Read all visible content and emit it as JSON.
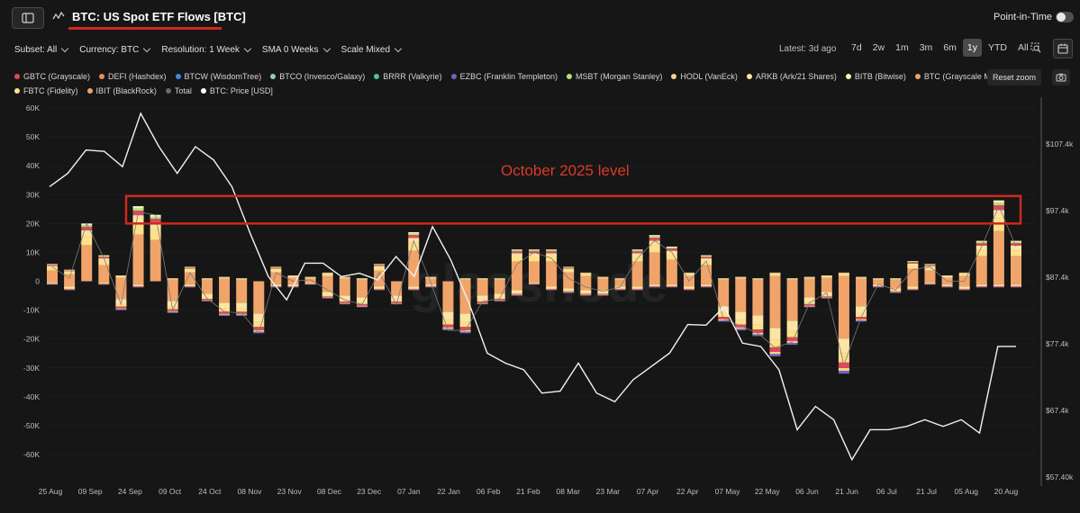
{
  "header": {
    "title": "BTC: US Spot ETF Flows [BTC]",
    "pit_label": "Point-in-Time"
  },
  "controls": {
    "subset": "Subset: All",
    "currency": "Currency: BTC",
    "resolution": "Resolution: 1 Week",
    "sma": "SMA 0 Weeks",
    "scale": "Scale Mixed",
    "latest": "Latest: 3d ago",
    "ranges": [
      "7d",
      "2w",
      "1m",
      "3m",
      "6m",
      "1y",
      "YTD",
      "All"
    ],
    "active_range": "1y",
    "reset_zoom": "Reset zoom"
  },
  "legend": [
    {
      "name": "GBTC (Grayscale)",
      "color": "#e0475b"
    },
    {
      "name": "DEFI (Hashdex)",
      "color": "#f08a5a"
    },
    {
      "name": "BTCW (WisdomTree)",
      "color": "#3d8bd9"
    },
    {
      "name": "BTCO (Invesco/Galaxy)",
      "color": "#8fd1a8"
    },
    {
      "name": "BRRR (Valkyrie)",
      "color": "#47c4a0"
    },
    {
      "name": "EZBC (Franklin Templeton)",
      "color": "#6f63c9"
    },
    {
      "name": "MSBT (Morgan Stanley)",
      "color": "#b6e07a"
    },
    {
      "name": "HODL (VanEck)",
      "color": "#f4d483"
    },
    {
      "name": "ARKB (Ark/21 Shares)",
      "color": "#fbe4a6"
    },
    {
      "name": "BITB (Bitwise)",
      "color": "#fff3b8"
    },
    {
      "name": "BTC (Grayscale Mini)",
      "color": "#f2a25c"
    },
    {
      "name": "FBTC (Fidelity)",
      "color": "#ffe08a"
    },
    {
      "name": "IBIT (BlackRock)",
      "color": "#f0a46a"
    },
    {
      "name": "Total",
      "color": "#6b6b6b"
    },
    {
      "name": "BTC: Price [USD]",
      "color": "#ffffff"
    }
  ],
  "annotation": {
    "text": "October 2025 level"
  },
  "watermark": "glassnode",
  "chart_data": {
    "type": "bar",
    "y_left_ticks": [
      "60K",
      "50K",
      "40K",
      "30K",
      "20K",
      "10K",
      "0",
      "-10K",
      "-20K",
      "-30K",
      "-40K",
      "-50K",
      "-60K"
    ],
    "y_right_ticks": [
      "$107.4k",
      "$97.4k",
      "$87.4k",
      "$77.4k",
      "$67.4k",
      "$57.40k"
    ],
    "x_ticks": [
      "25 Aug",
      "09 Sep",
      "24 Sep",
      "09 Oct",
      "24 Oct",
      "08 Nov",
      "23 Nov",
      "08 Dec",
      "23 Dec",
      "07 Jan",
      "22 Jan",
      "06 Feb",
      "21 Feb",
      "08 Mar",
      "23 Mar",
      "07 Apr",
      "22 Apr",
      "07 May",
      "22 May",
      "06 Jun",
      "21 Jun",
      "06 Jul",
      "21 Jul",
      "05 Aug",
      "20 Aug"
    ],
    "ylim": [
      -60000,
      60000
    ],
    "weekly_pos": [
      6000,
      4000,
      20000,
      9000,
      2000,
      26000,
      23000,
      1000,
      5000,
      1000,
      1500,
      1000,
      0,
      5000,
      2000,
      1500,
      3000,
      1500,
      1000,
      6000,
      0,
      17000,
      1500,
      0,
      1000,
      1000,
      1000,
      11000,
      11000,
      11000,
      5000,
      3000,
      1500,
      1000,
      11000,
      16000,
      12000,
      3000,
      9000,
      1000,
      1500,
      1000,
      3000,
      1000,
      1500,
      2000,
      3000,
      1500,
      1000,
      1000,
      7000,
      6000,
      2000,
      3000,
      14000,
      28000,
      14000
    ],
    "weekly_neg": [
      -1000,
      -3000,
      0,
      -1000,
      -10000,
      -2000,
      0,
      -11000,
      -2000,
      -7000,
      -12000,
      -12000,
      -18000,
      -2000,
      -2000,
      -1000,
      -6000,
      -8000,
      -9000,
      -3000,
      -8000,
      -3000,
      -2000,
      -17000,
      -18000,
      -8000,
      -7000,
      -5000,
      -1000,
      -3000,
      -4000,
      -5000,
      -5000,
      -3000,
      -3000,
      -2000,
      -2000,
      -3000,
      -2000,
      -14000,
      -17000,
      -19000,
      -26000,
      -22000,
      -9000,
      -6000,
      -32000,
      -14000,
      -2000,
      -4000,
      -3000,
      -1000,
      -2000,
      -3000,
      -2000,
      -2000,
      -2000
    ],
    "total": [
      5000,
      1000,
      20000,
      8000,
      -8000,
      24000,
      23000,
      -10000,
      3000,
      -6000,
      -10500,
      -11000,
      -18000,
      3000,
      0,
      500,
      -3000,
      -6500,
      -8000,
      3000,
      -8000,
      14000,
      -500,
      -17000,
      -17000,
      -7000,
      -6000,
      6000,
      10000,
      8000,
      1000,
      -2000,
      -3500,
      -2000,
      8000,
      14000,
      10000,
      0,
      7000,
      -13000,
      -15500,
      -18000,
      -23000,
      -21000,
      -7500,
      -4000,
      -29000,
      -12500,
      -1000,
      -3000,
      4000,
      5000,
      0,
      0,
      12000,
      26000,
      12000
    ],
    "price_usd": [
      101000,
      103000,
      106500,
      106300,
      104000,
      112000,
      107000,
      103000,
      107000,
      105000,
      101000,
      94000,
      87500,
      84000,
      89500,
      89500,
      87500,
      88000,
      87000,
      90500,
      87500,
      95000,
      90000,
      83500,
      76000,
      74500,
      73500,
      70000,
      70300,
      74500,
      70000,
      68700,
      72000,
      74000,
      76000,
      80300,
      80200,
      83000,
      77500,
      77000,
      73500,
      64500,
      68000,
      66000,
      60000,
      64500,
      64500,
      65000,
      66000,
      65000,
      66000,
      64000,
      77000,
      77000
    ],
    "highlight": {
      "y_from": 20000,
      "y_to": 29500
    }
  }
}
